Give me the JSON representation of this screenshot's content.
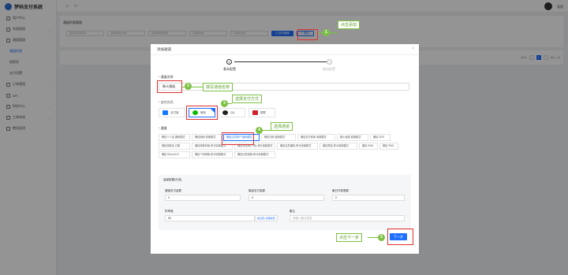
{
  "app": {
    "title": "梦码支付系统",
    "user": "管理"
  },
  "sidebar": {
    "items": [
      {
        "label": "用户中心"
      },
      {
        "label": "系统管理"
      },
      {
        "label": "通道管理"
      }
    ],
    "subitems": [
      {
        "label": "通道列表"
      },
      {
        "label": "收款码"
      },
      {
        "label": "支付设置"
      }
    ],
    "items2": [
      {
        "label": "订单管理"
      },
      {
        "label": "API"
      },
      {
        "label": "财务中心"
      },
      {
        "label": "工单系统"
      },
      {
        "label": "费用说明"
      }
    ]
  },
  "page": {
    "title": "通道列表管理",
    "filters": [
      "通道名称/通道ID",
      "请选择支付方式",
      "请选择所属通道",
      "请选择状态",
      "请选择分组"
    ],
    "search_label": "Q 查询通道",
    "add_label": "+ 添加",
    "pager": {
      "total": "共1条",
      "prev": "<",
      "page": "1",
      "next": ">",
      "goto": "前往 1 页"
    }
  },
  "modal": {
    "title": "添加通道",
    "close": "×",
    "steps": [
      {
        "num": "1",
        "label": "基本配置"
      },
      {
        "num": "2",
        "label": "路由配置"
      }
    ],
    "name_label": "通道名称",
    "name_value": "微卡通道",
    "pay_label": "支付方式",
    "pay_methods": [
      {
        "label": "支付宝",
        "color": "#1677ff"
      },
      {
        "label": "微信",
        "color": "#09bb07"
      },
      {
        "label": "QQ",
        "color": "#222222"
      },
      {
        "label": "银联",
        "color": "#d21f2f"
      }
    ],
    "channel_label": "通道",
    "channels": [
      "微信个人店-固码模式",
      "微信固码-收款模式",
      "微信店员商户-固码模式",
      "微信扫码-固码模式",
      "微信支付商家-收款模式",
      "超小经营-收款模式",
      "微信 DDS",
      "微信收款店-付款",
      "微信收款商家-积分收款模式",
      "微信赞赏码(个码)-积分收款模式",
      "微信店员通知-积分收款模式",
      "微信赞赏-积分收款模式",
      "微信 iPAD",
      "微信 iPAD",
      "微信 Ruhuv2V1",
      "微信个码收款-积分收款模式",
      "微信店员收款-积分收款模式"
    ],
    "options": {
      "title": "高级配置(可选)",
      "min_amount_label": "通道支付金额",
      "min_amount": "0",
      "max_amount_label": "最高支付金额",
      "max_amount": "0",
      "daily_limit_label": "最日付款限额",
      "daily_limit": "0",
      "rate_label": "扣率值",
      "rate": "50",
      "rate_btn": "前沿值+定额收费",
      "remark_label": "备注",
      "remark_placeholder": "请输入备注信息"
    },
    "next_label": "下一步"
  },
  "annotations": [
    {
      "num": "1",
      "text": "点击添加"
    },
    {
      "num": "2",
      "text": "填写通道名称"
    },
    {
      "num": "3",
      "text": "选择支付方式"
    },
    {
      "num": "4",
      "text": "选择通道"
    },
    {
      "num": "5",
      "text": "点击下一步"
    }
  ]
}
